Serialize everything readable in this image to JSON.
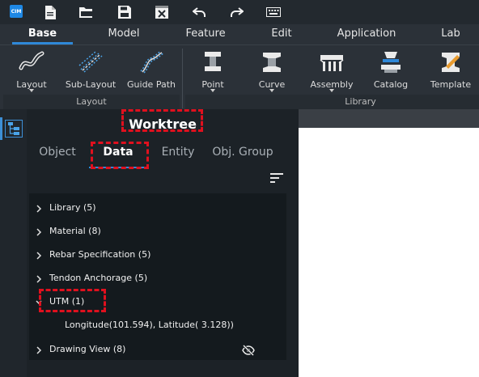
{
  "quick_access": {
    "logo_text": "CIM",
    "icons": [
      "new-file-icon",
      "open-folder-icon",
      "save-icon",
      "close-file-icon",
      "undo-icon",
      "redo-icon",
      "keyboard-icon"
    ]
  },
  "menu": {
    "tabs": [
      "Base",
      "Model",
      "Feature",
      "Edit",
      "Application",
      "Lab"
    ],
    "active": "Base"
  },
  "ribbon": {
    "groups": [
      {
        "label": "Layout",
        "items": [
          {
            "label": "Layout",
            "icon": "layout-curve-icon",
            "dropdown": true
          },
          {
            "label": "Sub-Layout",
            "icon": "sub-layout-icon",
            "dropdown": false
          },
          {
            "label": "Guide Path",
            "icon": "guide-path-icon",
            "dropdown": false
          }
        ]
      },
      {
        "label": "Library",
        "items": [
          {
            "label": "Point",
            "icon": "i-beam-point-icon",
            "dropdown": true
          },
          {
            "label": "Curve",
            "icon": "i-beam-curve-icon",
            "dropdown": true
          },
          {
            "label": "Assembly",
            "icon": "assembly-icon",
            "dropdown": true
          },
          {
            "label": "Catalog",
            "icon": "catalog-icon",
            "dropdown": false
          },
          {
            "label": "Template",
            "icon": "template-icon",
            "dropdown": false
          }
        ]
      }
    ]
  },
  "worktree": {
    "title": "Worktree",
    "tabs": [
      "Object",
      "Data",
      "Entity",
      "Obj. Group"
    ],
    "active_tab": "Data",
    "items": [
      {
        "label": "Library (5)"
      },
      {
        "label": "Material (8)"
      },
      {
        "label": "Rebar Specification (5)"
      },
      {
        "label": "Tendon Anchorage (5)"
      },
      {
        "label": "UTM (1)",
        "expanded": true,
        "children": [
          "Longitude(101.594), Latitude( 3.128))"
        ]
      },
      {
        "label": "Drawing View (8)",
        "hidden_icon": "eye-off-icon"
      }
    ]
  },
  "colors": {
    "accent": "#2f88d8",
    "highlight": "#e0101e",
    "panel_bg": "#1c2227",
    "ribbon_bg": "#2b3138"
  }
}
